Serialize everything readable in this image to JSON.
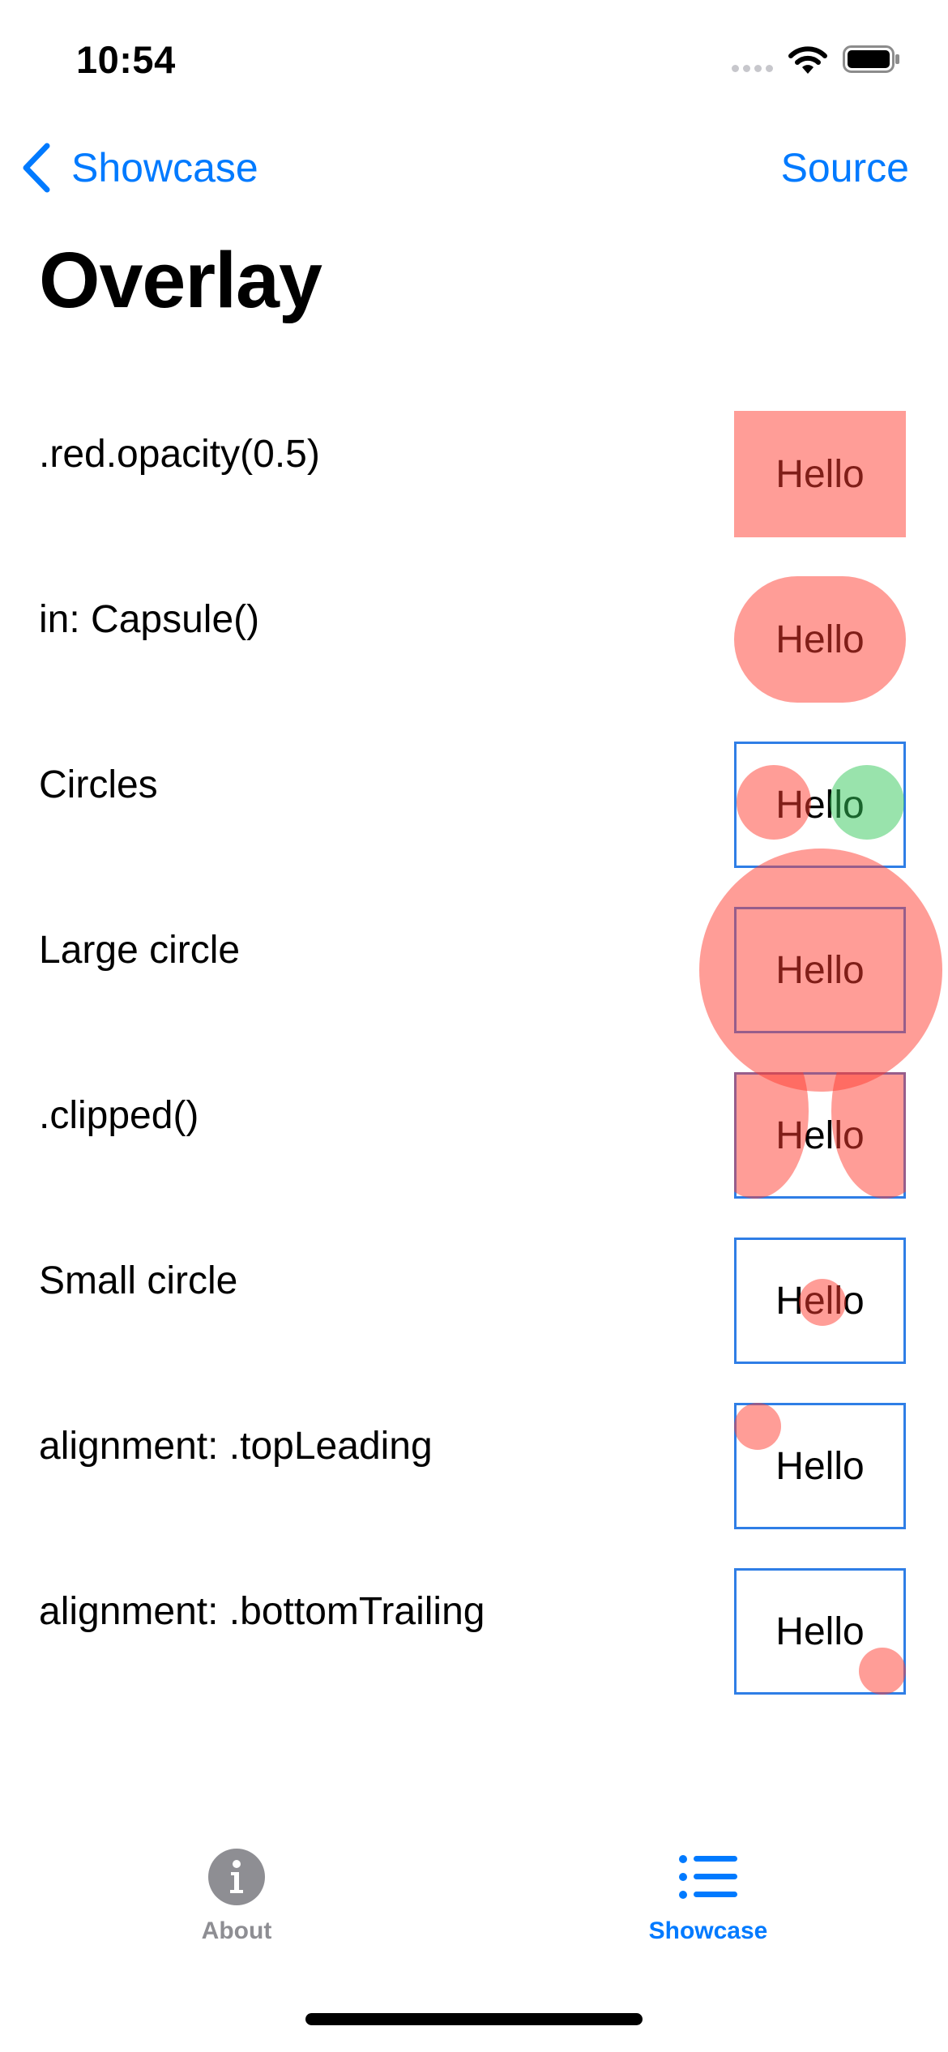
{
  "status_bar": {
    "time": "10:54"
  },
  "nav": {
    "back_label": "Showcase",
    "action_label": "Source"
  },
  "title": "Overlay",
  "rows": [
    {
      "label": ".red.opacity(0.5)",
      "hello": "Hello"
    },
    {
      "label": "in: Capsule()",
      "hello": "Hello"
    },
    {
      "label": "Circles",
      "hello": "Hello"
    },
    {
      "label": "Large circle",
      "hello": "Hello"
    },
    {
      "label": ".clipped()",
      "hello": "Hello"
    },
    {
      "label": "Small circle",
      "hello": "Hello"
    },
    {
      "label": "alignment: .topLeading",
      "hello": "Hello"
    },
    {
      "label": "alignment: .bottomTrailing",
      "hello": "Hello"
    }
  ],
  "tabs": [
    {
      "label": "About",
      "icon": "info-circle-icon"
    },
    {
      "label": "Showcase",
      "icon": "list-bullet-icon",
      "selected": true
    }
  ],
  "colors": {
    "accent": "#007aff",
    "overlay_red": "#ff3b30",
    "overlay_green": "#34c759",
    "border_blue": "#2f7ee6",
    "tab_inactive": "#8e8e93"
  }
}
